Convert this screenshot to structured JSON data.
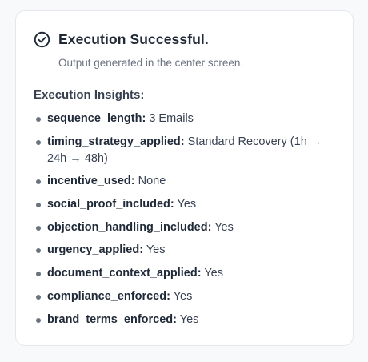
{
  "card": {
    "title": "Execution Successful.",
    "subtitle": "Output generated in the center screen.",
    "insights_heading": "Execution Insights:",
    "insights": [
      {
        "key": "sequence_length:",
        "value": "3 Emails"
      },
      {
        "key": "timing_strategy_applied:",
        "value": "Standard Recovery (1h → 24h → 48h)"
      },
      {
        "key": "incentive_used:",
        "value": "None"
      },
      {
        "key": "social_proof_included:",
        "value": "Yes"
      },
      {
        "key": "objection_handling_included:",
        "value": "Yes"
      },
      {
        "key": "urgency_applied:",
        "value": "Yes"
      },
      {
        "key": "document_context_applied:",
        "value": "Yes"
      },
      {
        "key": "compliance_enforced:",
        "value": "Yes"
      },
      {
        "key": "brand_terms_enforced:",
        "value": "Yes"
      }
    ]
  },
  "icons": {
    "status": "check-circle-icon"
  },
  "colors": {
    "background": "#f8f9fb",
    "card": "#ffffff",
    "border": "#e5e7eb",
    "text_primary": "#1f2937",
    "text_secondary": "#6b7280"
  }
}
